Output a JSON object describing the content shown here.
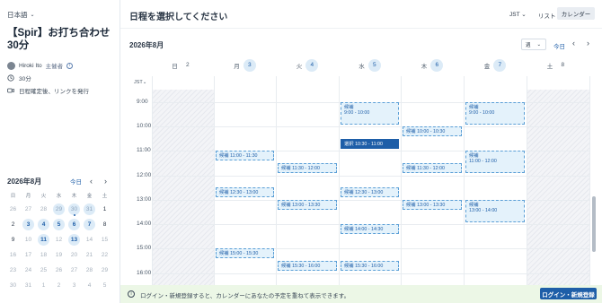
{
  "sidebar": {
    "language": "日本語",
    "event_title": "【Spir】お打ち合わせ30分",
    "host_name": "Hiroki Ito",
    "host_role": "主催者",
    "duration": "30分",
    "confirm_note": "日程確定後、リンクを発行"
  },
  "mini_calendar": {
    "month": "2026年8月",
    "today": "今日",
    "weekdays": [
      "日",
      "月",
      "火",
      "水",
      "木",
      "金",
      "土"
    ],
    "days": [
      "26",
      "27",
      "28",
      "29",
      "30",
      "31",
      "1",
      "2",
      "3",
      "4",
      "5",
      "6",
      "7",
      "8",
      "9",
      "10",
      "11",
      "12",
      "13",
      "14",
      "15",
      "16",
      "17",
      "18",
      "19",
      "20",
      "21",
      "22",
      "23",
      "24",
      "25",
      "26",
      "27",
      "28",
      "29",
      "30",
      "31",
      "1",
      "2",
      "3",
      "4",
      "5"
    ]
  },
  "header": {
    "title": "日程を選択してください",
    "timezone": "JST",
    "view_list": "リスト",
    "view_calendar": "カレンダー"
  },
  "week": {
    "month": "2026年8月",
    "range": "週",
    "today": "今日",
    "tz": "JST",
    "days": [
      {
        "name": "日",
        "num": "2"
      },
      {
        "name": "月",
        "num": "3"
      },
      {
        "name": "火",
        "num": "4"
      },
      {
        "name": "水",
        "num": "5"
      },
      {
        "name": "木",
        "num": "6"
      },
      {
        "name": "金",
        "num": "7"
      },
      {
        "name": "土",
        "num": "8"
      }
    ],
    "hours": [
      "9:00",
      "10:00",
      "11:00",
      "12:00",
      "13:00",
      "14:00",
      "15:00",
      "16:00"
    ]
  },
  "events": [
    {
      "label": "候補 9:00 - 10:00",
      "day": "水"
    },
    {
      "label": "候補 9:00 - 10:00",
      "day": "金"
    },
    {
      "label": "候補 10:00 - 10:30",
      "day": "木"
    },
    {
      "label": "選択 10:30 - 11:00",
      "day": "水",
      "selected": true
    },
    {
      "label": "候補 11:00 - 11:30",
      "day": "月"
    },
    {
      "label": "候補 11:00 - 12:00",
      "day": "金"
    },
    {
      "label": "候補 11:30 - 12:00",
      "day": "火"
    },
    {
      "label": "候補 11:30 - 12:00",
      "day": "木"
    },
    {
      "label": "候補 12:30 - 13:00",
      "day": "月"
    },
    {
      "label": "候補 12:30 - 13:00",
      "day": "水"
    },
    {
      "label": "候補 13:00 - 13:30",
      "day": "火"
    },
    {
      "label": "候補 13:00 - 13:30",
      "day": "木"
    },
    {
      "label": "候補 13:00 - 14:00",
      "day": "金"
    },
    {
      "label": "候補 14:00 - 14:30",
      "day": "水"
    },
    {
      "label": "候補 15:00 - 15:30",
      "day": "月"
    },
    {
      "label": "候補 15:30 - 16:00",
      "day": "火"
    },
    {
      "label": "候補 15:30 - 16:00",
      "day": "水"
    }
  ],
  "footer": {
    "message": "ログイン・新規登録すると、カレンダーにあなたの予定を重ねて表示できます。",
    "button": "ログイン・新規登録"
  },
  "colors": {
    "accent": "#1e5ea8",
    "candidate_bg": "#e4f2fb",
    "footer_bg": "#ecf7e6"
  }
}
